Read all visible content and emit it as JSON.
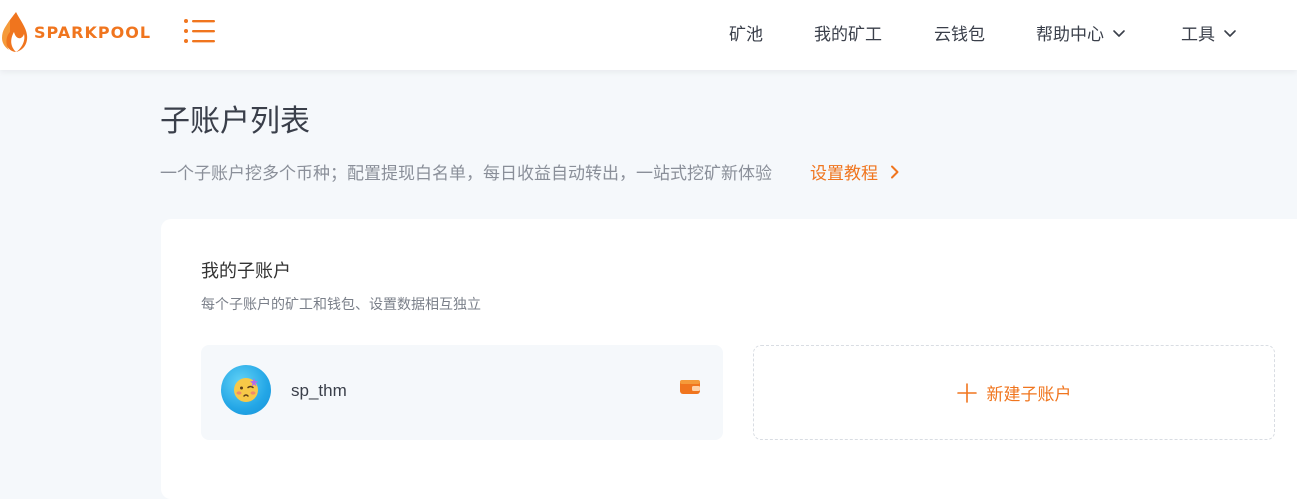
{
  "brand": {
    "name": "SPARKPOOL",
    "color": "#f0751e"
  },
  "nav": {
    "items": [
      {
        "label": "矿池"
      },
      {
        "label": "我的矿工"
      },
      {
        "label": "云钱包"
      },
      {
        "label": "帮助中心"
      },
      {
        "label": "工具"
      }
    ]
  },
  "page": {
    "title": "子账户列表",
    "subtitle": "一个子账户挖多个币种；配置提现白名单，每日收益自动转出，一站式挖矿新体验",
    "tutorial_link": "设置教程"
  },
  "panel": {
    "title": "我的子账户",
    "description": "每个子账户的矿工和钱包、设置数据相互独立",
    "accounts": [
      {
        "name": "sp_thm",
        "avatar_icon": "face-emoji-icon"
      }
    ],
    "new_account_label": "新建子账户"
  },
  "icons": {
    "menu": "menu-list-icon",
    "chevron": "chevron-down-icon",
    "arrow": "chevron-right-icon",
    "wallet": "wallet-icon",
    "plus": "plus-icon"
  }
}
